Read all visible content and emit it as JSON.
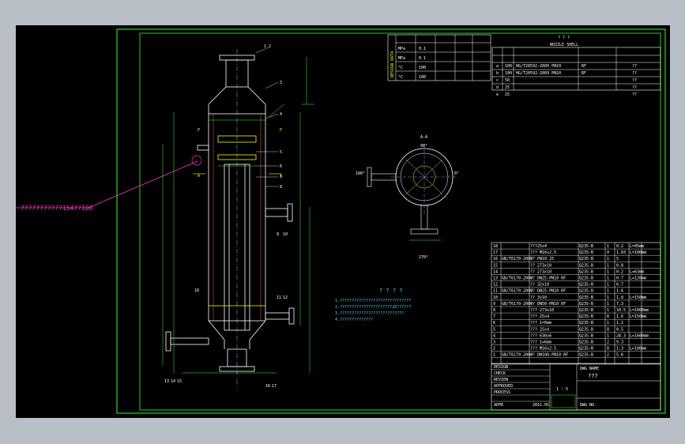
{
  "annotation": {
    "callout": "???????????154??100"
  },
  "top_title": "? ? ?",
  "nozzle_table": {
    "title": "NOZZLE SHELL",
    "header": [
      "",
      "",
      "",
      "",
      "",
      "",
      "",
      ""
    ],
    "rows": [
      {
        "mark": "a",
        "dn": "100",
        "std": "HG/T20592-2009 PN10",
        "face": "RF",
        "ht": "??"
      },
      {
        "mark": "b",
        "dn": "100",
        "std": "HG/T20592-2009 PN10",
        "face": "RF",
        "ht": "??"
      },
      {
        "mark": "c",
        "dn": "50",
        "std": "",
        "face": "",
        "ht": "??"
      },
      {
        "mark": "d",
        "dn": "25",
        "std": "",
        "face": "",
        "ht": "??"
      },
      {
        "mark": "e",
        "dn": "25",
        "std": "",
        "face": "",
        "ht": "??"
      }
    ]
  },
  "design_data": {
    "side": "DESIGN DATA",
    "rows": [
      [
        "MPa",
        "0.1",
        "??",
        "??",
        "??",
        ""
      ],
      [
        "MPa",
        "0.1",
        "??",
        "??",
        "",
        ""
      ],
      [
        "°C",
        "100",
        "",
        "",
        "",
        ""
      ],
      [
        "°C",
        "100",
        "",
        "",
        "",
        ""
      ]
    ]
  },
  "section_aa": {
    "label": "A-A",
    "angle_top": "90°",
    "angle_left": "180°",
    "angle_right": "0°",
    "angle_bottom": "270°"
  },
  "notes": {
    "title": "? ? ? ?",
    "lines": [
      "1.??????????????????????????????",
      "2.??????????????????????20??????",
      "3.???????????????????????????",
      "4.??????????????"
    ]
  },
  "parts_list": {
    "rows": [
      {
        "no": "18",
        "std": "",
        "name": "???25x4",
        "mat": "Q235-B",
        "qty": "1",
        "w": "0.2",
        "note": "L=45mm"
      },
      {
        "no": "17",
        "std": "",
        "name": "??? M16x2.5",
        "mat": "Q235-B",
        "qty": "4",
        "w": "1.03",
        "note": "L=100mm"
      },
      {
        "no": "16",
        "std": "GB/T6170-2000",
        "name": "?? PN10 25",
        "mat": "Q235-B",
        "qty": "1",
        "w": "5",
        "note": ""
      },
      {
        "no": "15",
        "std": "",
        "name": "?? 273x10",
        "mat": "Q235-B",
        "qty": "1",
        "w": "0.8",
        "note": ""
      },
      {
        "no": "14",
        "std": "",
        "name": "?? 273x10",
        "mat": "Q235-B",
        "qty": "1",
        "w": "0.2",
        "note": "L=63mm"
      },
      {
        "no": "13",
        "std": "GB/T6170-2000",
        "name": "?? DN25-PN10 RF",
        "mat": "Q235-B",
        "qty": "1",
        "w": "0.7",
        "note": "L=120mm"
      },
      {
        "no": "12",
        "std": "",
        "name": "?? 32x10",
        "mat": "Q235-B",
        "qty": "1",
        "w": "0.7",
        "note": ""
      },
      {
        "no": "11",
        "std": "GB/T6170-2000",
        "name": "?? DN25-PN10 RF",
        "mat": "Q235-B",
        "qty": "1",
        "w": "1.6",
        "note": ""
      },
      {
        "no": "10",
        "std": "",
        "name": "?? 3x10",
        "mat": "Q235-B",
        "qty": "1",
        "w": "1.8",
        "note": "L=150mm"
      },
      {
        "no": "9",
        "std": "GB/T6170-2000",
        "name": "?? DN50-PN10 RF",
        "mat": "Q235-B",
        "qty": "1",
        "w": "7.3",
        "note": ""
      },
      {
        "no": "8",
        "std": "",
        "name": "??? 273x10",
        "mat": "Q235-B",
        "qty": "1",
        "w": "10.5",
        "note": "L=1000mm"
      },
      {
        "no": "7",
        "std": "",
        "name": "??? 25x4",
        "mat": "Q235-B",
        "qty": "8",
        "w": "1.6",
        "note": "L=150mm"
      },
      {
        "no": "6",
        "std": "",
        "name": "??? 1=6mm",
        "mat": "Q235-B",
        "qty": "1",
        "w": "1.2",
        "note": ""
      },
      {
        "no": "5",
        "std": "",
        "name": "??? 25x4",
        "mat": "Q235-B",
        "qty": "8",
        "w": "0.5",
        "note": ""
      },
      {
        "no": "4",
        "std": "",
        "name": "??? 630x6",
        "mat": "Q235-B",
        "qty": "1",
        "w": "28.3",
        "note": "L=1600mm"
      },
      {
        "no": "3",
        "std": "",
        "name": "??? 1=6mm",
        "mat": "Q235-B",
        "qty": "2",
        "w": "9.3",
        "note": ""
      },
      {
        "no": "2",
        "std": "",
        "name": "??? M16x2.5",
        "mat": "Q235-B",
        "qty": "8",
        "w": "1.3",
        "note": "L=100mm"
      },
      {
        "no": "1",
        "std": "GB/T6170-2000",
        "name": "?? DN100-PN10 RF",
        "mat": "Q235-B",
        "qty": "2",
        "w": "5.6",
        "note": ""
      }
    ],
    "header": [
      "",
      "",
      "",
      "",
      "",
      "",
      "",
      ""
    ]
  },
  "title_block": {
    "left_rows": [
      "DESIGN",
      "CHECK",
      "REVIEW",
      "APPROVED",
      "PROCESS",
      "",
      "APPR"
    ],
    "scale": "1 : 5",
    "dwg_name_label": "DWG NAME",
    "dwg_name": "???",
    "dwg_no_label": "DWG NO.",
    "date": "2011.05"
  },
  "callouts": [
    "1",
    "2",
    "3",
    "4",
    "5",
    "6",
    "7",
    "8",
    "9",
    "10",
    "11",
    "12",
    "13",
    "14",
    "15",
    "16",
    "17",
    "18"
  ]
}
